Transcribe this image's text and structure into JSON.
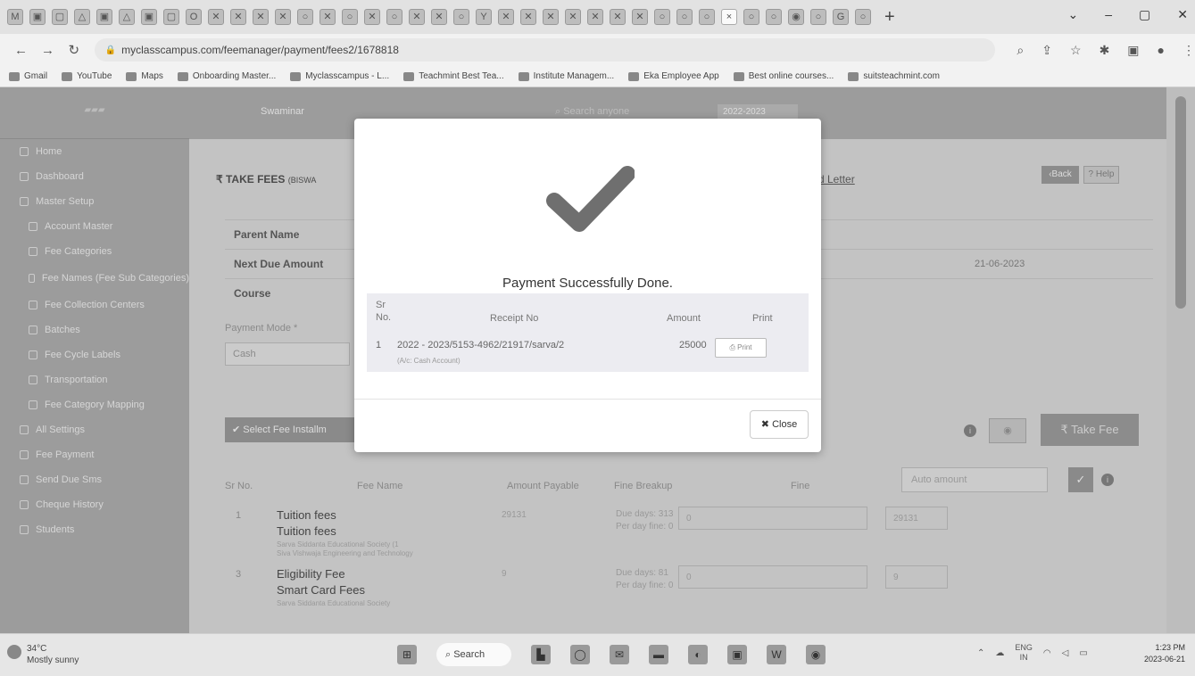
{
  "browser": {
    "tabs": [
      "M",
      "▣",
      "▢",
      "△",
      "▣",
      "△",
      "▣",
      "▢",
      "O",
      "✕",
      "✕",
      "✕",
      "✕",
      "○",
      "✕",
      "○",
      "✕",
      "○",
      "✕",
      "✕",
      "○",
      "Y",
      "✕",
      "✕",
      "✕",
      "✕",
      "✕",
      "✕",
      "✕",
      "○",
      "○",
      "○"
    ],
    "active_tab_close": "×",
    "tabs_after": [
      "○",
      "○",
      "◉",
      "○",
      "G",
      "○"
    ],
    "new_tab": "+",
    "window_controls": [
      "⌄",
      "–",
      "▢",
      "✕"
    ],
    "url": "myclasscampus.com/feemanager/payment/fees2/1678818",
    "bookmarks": [
      "Gmail",
      "YouTube",
      "Maps",
      "Onboarding Master...",
      "Myclasscampus - L...",
      "Teachmint Best Tea...",
      "Institute Managem...",
      "Eka Employee App",
      "Best online courses...",
      "suitsteachmint.com"
    ]
  },
  "app": {
    "org_name": "Swaminar",
    "search_placeholder": "Search anyone",
    "session": "2022-2023",
    "menu": [
      {
        "label": "Home",
        "sub": false
      },
      {
        "label": "Dashboard",
        "sub": false
      },
      {
        "label": "Master Setup",
        "sub": false
      },
      {
        "label": "Account Master",
        "sub": true
      },
      {
        "label": "Fee Categories",
        "sub": true
      },
      {
        "label": "Fee Names (Fee Sub Categories)",
        "sub": true
      },
      {
        "label": "Fee Collection Centers",
        "sub": true
      },
      {
        "label": "Batches",
        "sub": true
      },
      {
        "label": "Fee Cycle Labels",
        "sub": true
      },
      {
        "label": "Transportation",
        "sub": true
      },
      {
        "label": "Fee Category Mapping",
        "sub": true
      },
      {
        "label": "All Settings",
        "sub": false
      },
      {
        "label": "Fee Payment",
        "sub": false
      },
      {
        "label": "Send Due Sms",
        "sub": false
      },
      {
        "label": "Cheque History",
        "sub": false
      },
      {
        "label": "Students",
        "sub": false
      }
    ],
    "page_title": "₹ TAKE FEES",
    "page_title_sub": "(BISWA",
    "letter_link": "d Letter",
    "back_label": "‹Back",
    "help_label": "? Help",
    "info_rows": [
      {
        "label": "Parent Name",
        "value": ""
      },
      {
        "label": "Next Due Amount",
        "value": "21-06-2023"
      },
      {
        "label": "Course",
        "value": ""
      }
    ],
    "payment_mode_label": "Payment Mode *",
    "payment_mode_value": "Cash",
    "select_installments": "✔ Select Fee Installm",
    "take_fee": "₹ Take Fee",
    "auto_amount_placeholder": "Auto amount",
    "fee_table_headers": [
      "Sr No.",
      "Fee Name",
      "Amount Payable",
      "Fine Breakup",
      "Fine"
    ],
    "fee_rows": [
      {
        "sr": "1",
        "name1": "Tuition fees",
        "name2": "Tuition fees",
        "org": "Sarva Siddanta Educational Society (1",
        "org2": "Siva Vishwaja Engineering and Technology",
        "amount": "29131",
        "due_days": "Due days: 313",
        "per_day": "Per day fine: 0",
        "fine": "0",
        "pay": "29131"
      },
      {
        "sr": "3",
        "name1": "Eligibility Fee",
        "name2": "Smart Card Fees",
        "org": "Sarva Siddanta Educational Society",
        "org2": "",
        "amount": "9",
        "due_days": "Due days: 81",
        "per_day": "Per day fine: 0",
        "fine": "0",
        "pay": "9"
      }
    ]
  },
  "modal": {
    "message": "Payment Successfully Done.",
    "headers": {
      "sr": "Sr No.",
      "receipt": "Receipt No",
      "amount": "Amount",
      "print": "Print"
    },
    "row": {
      "sr": "1",
      "receipt": "2022 - 2023/5153-4962/21917/sarva/2",
      "account": "(A/c: Cash Account)",
      "amount": "25000",
      "print_label": "⎙ Print"
    },
    "close_label": "✖ Close",
    "tick_color": "#6f6f6f"
  },
  "taskbar": {
    "temperature": "34°C",
    "weather": "Mostly sunny",
    "search_label": "⌕ Search",
    "lang": "ENG",
    "region": "IN",
    "time": "1:23 PM",
    "date": "2023-06-21"
  }
}
